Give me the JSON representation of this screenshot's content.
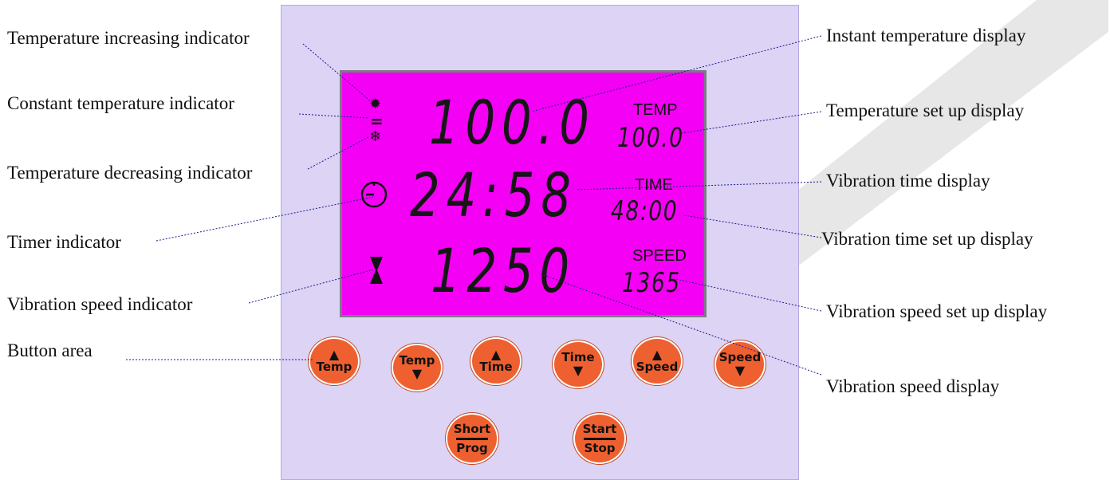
{
  "labels": {
    "temp_increasing": "Temperature increasing indicator",
    "constant_temp": "Constant temperature indicator",
    "temp_decreasing": "Temperature decreasing indicator",
    "timer": "Timer indicator",
    "vibration_speed_ind": "Vibration speed indicator",
    "button_area": "Button area",
    "instant_temp": "Instant temperature display",
    "temp_setup": "Temperature set up display",
    "vib_time": "Vibration time display",
    "vib_time_setup": "Vibration time set up display",
    "vib_speed_setup": "Vibration speed set up display",
    "vib_speed": "Vibration speed display"
  },
  "lcd": {
    "temp_value": "100.0",
    "temp_caption": "TEMP",
    "temp_set": "100.0",
    "time_value": "24:58",
    "time_caption": "TIME",
    "time_set": "48:00",
    "speed_value": "1250",
    "speed_caption": "SPEED",
    "speed_set": "1365"
  },
  "buttons": {
    "temp_up": "Temp",
    "temp_down": "Temp",
    "time_up": "Time",
    "time_down": "Time",
    "speed_up": "Speed",
    "speed_down": "Speed",
    "short_top": "Short",
    "short_bottom": "Prog",
    "start_top": "Start",
    "start_bottom": "Stop"
  },
  "icons": {
    "increasing": "sun-icon",
    "constant": "equals-icon",
    "decreasing": "snowflake-icon",
    "timer": "clock-icon",
    "speed": "hourglass-icon"
  },
  "colors": {
    "panel": "#dcd3f5",
    "lcd": "#f400f4",
    "button": "#ef6030",
    "watermark": "#c8c8c8"
  }
}
